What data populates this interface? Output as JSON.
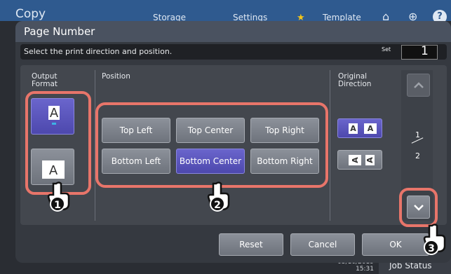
{
  "background": {
    "app_title": "Copy",
    "tabs": [
      "Storage",
      "Settings",
      "Template"
    ],
    "date": "05/10/2019",
    "time": "15:31",
    "job_status": "Job Status"
  },
  "dialog": {
    "title": "Page Number",
    "instruction": "Select the print direction and position.",
    "set_label": "Set",
    "set_value": "1"
  },
  "sections": {
    "output_format": "Output\nFormat",
    "position": "Position",
    "original_direction": "Original\nDirection"
  },
  "output_format": {
    "options": [
      "A",
      "A"
    ],
    "selected_index": 0
  },
  "position": {
    "row1": [
      "Top Left",
      "Top Center",
      "Top Right"
    ],
    "row2": [
      "Bottom Left",
      "Bottom Center",
      "Bottom Right"
    ],
    "selected": "Bottom Center"
  },
  "original_direction": {
    "option1_glyphs": [
      "A",
      "A"
    ],
    "option2_glyphs": [
      "A",
      "A"
    ],
    "selected_index": 0
  },
  "pager": {
    "current": "1",
    "total": "2"
  },
  "buttons": {
    "reset": "Reset",
    "cancel": "Cancel",
    "ok": "OK"
  },
  "annotations": {
    "step1": "1",
    "step2": "2",
    "step3": "3"
  },
  "colors": {
    "accent_blue": "#5550bb",
    "highlight_ring": "#e8756a",
    "header_blue": "#2f5a8f"
  }
}
